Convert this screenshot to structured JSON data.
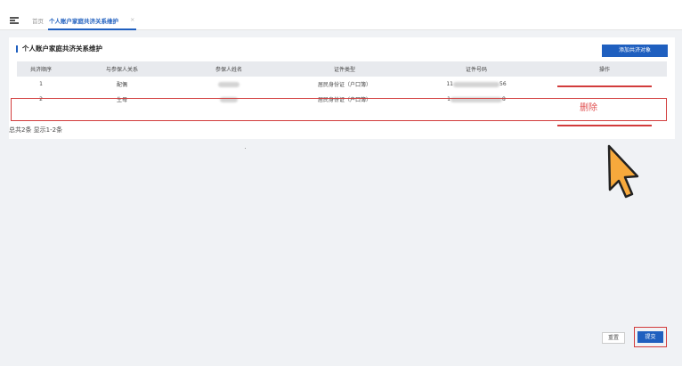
{
  "header": {
    "home_tab": "首页",
    "active_tab": "个人账户家庭共济关系维护",
    "close_glyph": "×"
  },
  "panel": {
    "title": "个人账户家庭共济关系维护",
    "add_button": "添加共济对象"
  },
  "table": {
    "columns": [
      "共济顺序",
      "与参保人关系",
      "参保人姓名",
      "证件类型",
      "证件号码",
      "操作"
    ],
    "rows": [
      {
        "order": "1",
        "relation": "配偶",
        "id_type": "居民身份证（户口簿）",
        "id_prefix": "11",
        "id_suffix": "56"
      },
      {
        "order": "2",
        "relation": "生母",
        "id_type": "居民身份证（户口簿）",
        "id_prefix": "1",
        "id_suffix": "8"
      }
    ]
  },
  "summary": "总共2条 显示1-2条",
  "delete_label": "删除",
  "footer": {
    "reset_label": "重置",
    "submit_label": "提交"
  },
  "colors": {
    "accent": "#1f5fbf",
    "highlight": "#d23c3c",
    "cursor": "#f7a93c"
  }
}
